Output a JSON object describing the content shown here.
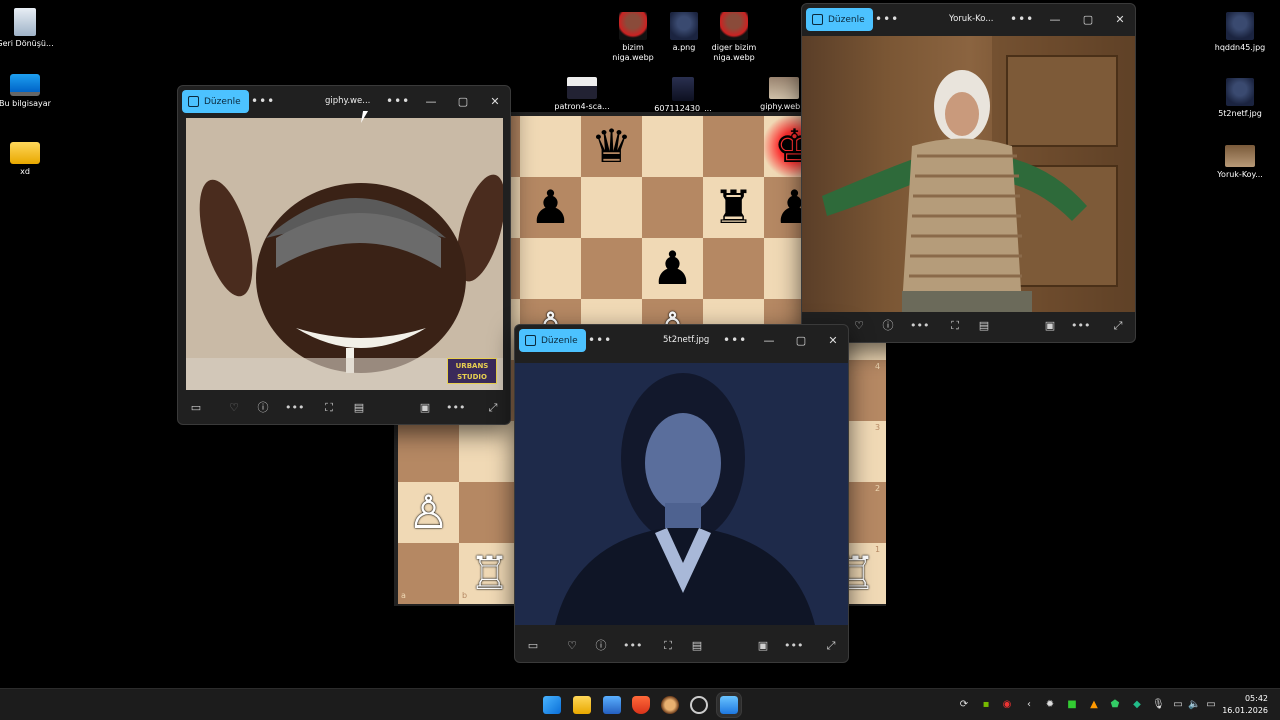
{
  "desktop": {
    "icons": [
      {
        "label": "Geri Dönüşü..."
      },
      {
        "label": "Bu bilgisayar"
      },
      {
        "label": "xd"
      },
      {
        "label": "bizim niga.webp"
      },
      {
        "label": "a.png"
      },
      {
        "label": "diger bizim niga.webp"
      },
      {
        "label": "patron4-sca..."
      },
      {
        "label": "607112430_..."
      },
      {
        "label": "giphy.web..."
      },
      {
        "label": "hqddn45.jpg"
      },
      {
        "label": "5t2netf.jpg"
      },
      {
        "label": "Yoruk-Koy..."
      }
    ]
  },
  "windows": {
    "giphy": {
      "edit_label": "Düzenle",
      "title": "giphy.we...",
      "watermark": "URBANS STUDIO"
    },
    "yoruk": {
      "edit_label": "Düzenle",
      "title": "Yoruk-Ko..."
    },
    "netf": {
      "edit_label": "Düzenle",
      "title": "5t2netf.jpg"
    }
  },
  "chess": {
    "ranks": [
      "4",
      "3",
      "2",
      "1"
    ],
    "files": [
      "a",
      "b"
    ]
  },
  "taskbar": {
    "time": "05:42",
    "date": "16.01.2026"
  },
  "colors": {
    "accent": "#4cc2ff",
    "light_square": "#f0d9b5",
    "dark_square": "#b58863"
  }
}
